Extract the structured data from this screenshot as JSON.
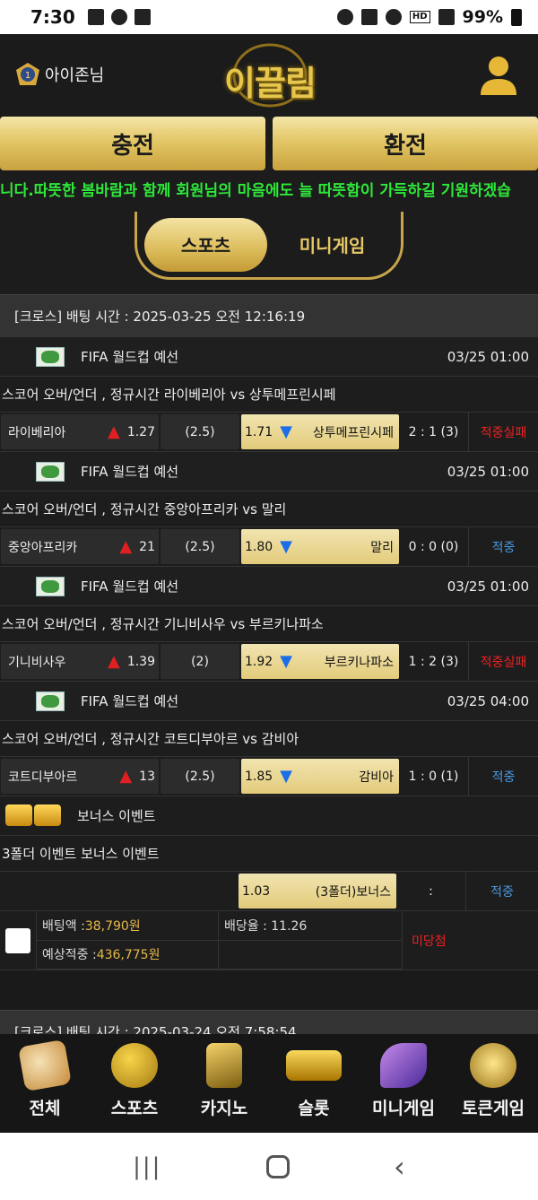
{
  "status_bar": {
    "time": "7:30",
    "battery": "99%",
    "volte": "HD"
  },
  "header": {
    "username": "아이존님",
    "logo": "이끌림"
  },
  "cash": {
    "deposit": "충전",
    "withdraw": "환전"
  },
  "notice": "니다.따뜻한 봄바람과 함께 회원님의 마음에도 늘 따뜻함이 가득하길 기원하겠습",
  "tabs": {
    "sports": "스포츠",
    "minigame": "미니게임"
  },
  "bets": [
    {
      "header": "[크로스] 배팅 시간 : 2025-03-25 오전 12:16:19",
      "games": [
        {
          "league": "FIFA 월드컵 예선",
          "time": "03/25 01:00",
          "title": "스코어 오버/언더 , 정규시간 라이베리아  vs  상투메프린시페",
          "home": "라이베리아",
          "home_odds": "1.27",
          "line": "(2.5)",
          "away_odds": "1.71",
          "away": "상투메프린시페",
          "score": "2 : 1 (3)",
          "result": "적중실패",
          "result_type": "lose"
        },
        {
          "league": "FIFA 월드컵 예선",
          "time": "03/25 01:00",
          "title": "스코어 오버/언더 , 정규시간 중앙아프리카  vs  말리",
          "home": "중앙아프리카",
          "home_odds": "21",
          "line": "(2.5)",
          "away_odds": "1.80",
          "away": "말리",
          "score": "0 : 0 (0)",
          "result": "적중",
          "result_type": "win"
        },
        {
          "league": "FIFA 월드컵 예선",
          "time": "03/25 01:00",
          "title": "스코어 오버/언더 , 정규시간 기니비사우  vs  부르키나파소",
          "home": "기니비사우",
          "home_odds": "1.39",
          "line": "(2)",
          "away_odds": "1.92",
          "away": "부르키나파소",
          "score": "1 : 2 (3)",
          "result": "적중실패",
          "result_type": "lose"
        },
        {
          "league": "FIFA 월드컵 예선",
          "time": "03/25 04:00",
          "title": "스코어 오버/언더 , 정규시간 코트디부아르  vs  감비아",
          "home": "코트디부아르",
          "home_odds": "13",
          "line": "(2.5)",
          "away_odds": "1.85",
          "away": "감비아",
          "score": "1 : 0 (1)",
          "result": "적중",
          "result_type": "win"
        }
      ],
      "bonus": {
        "label": "보너스 이벤트",
        "title": "3폴더 이벤트 보너스 이벤트",
        "odds": "1.03",
        "name": "(3폴더)보너스",
        "score": ":",
        "result": "적중"
      },
      "summary": {
        "bet_amount_label": "배팅액 : ",
        "bet_amount": "38,790원",
        "rate_label": "배당율 : 11.26",
        "expected_label": "예상적중 : ",
        "expected": "436,775원",
        "status": "미당첨"
      }
    },
    {
      "header": "[크로스] 배팅 시간 : 2025-03-24 오전 7:58:54"
    }
  ],
  "bottom_nav": [
    {
      "label": "전체",
      "icon": "dice-icon"
    },
    {
      "label": "스포츠",
      "icon": "soccer-ball-icon"
    },
    {
      "label": "카지노",
      "icon": "cards-icon"
    },
    {
      "label": "슬롯",
      "icon": "slot-777-icon"
    },
    {
      "label": "미니게임",
      "icon": "rocket-icon"
    },
    {
      "label": "토큰게임",
      "icon": "roulette-icon"
    }
  ]
}
